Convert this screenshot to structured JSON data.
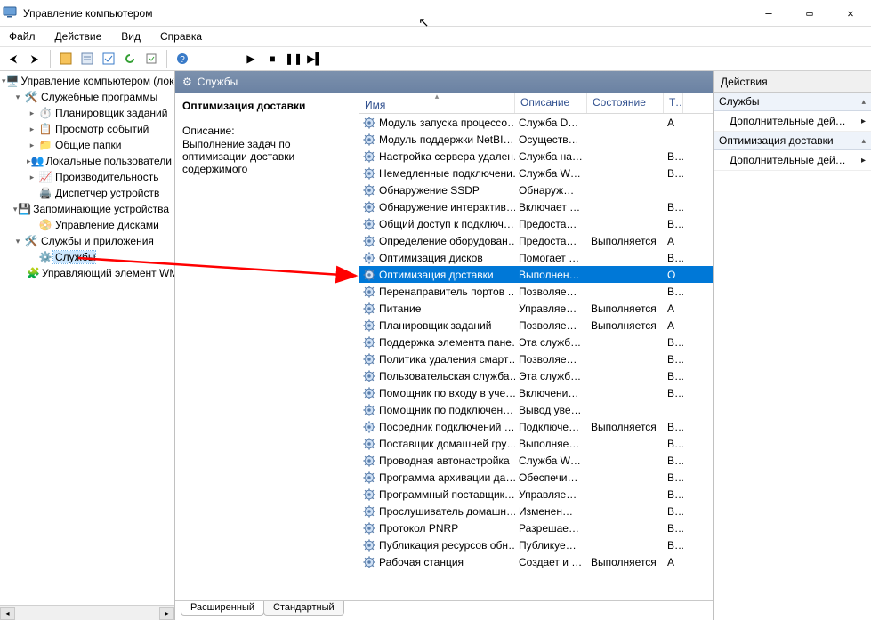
{
  "title": "Управление компьютером",
  "menu": {
    "file": "Файл",
    "action": "Действие",
    "view": "Вид",
    "help": "Справка"
  },
  "tree": {
    "root": {
      "label": "Управление компьютером (локал"
    },
    "syssw": {
      "label": "Служебные программы"
    },
    "scheduler": {
      "label": "Планировщик заданий"
    },
    "eventvwr": {
      "label": "Просмотр событий"
    },
    "shared": {
      "label": "Общие папки"
    },
    "localusers": {
      "label": "Локальные пользователи и"
    },
    "perf": {
      "label": "Производительность"
    },
    "devmgr": {
      "label": "Диспетчер устройств"
    },
    "storage": {
      "label": "Запоминающие устройства"
    },
    "diskmgmt": {
      "label": "Управление дисками"
    },
    "svcapps": {
      "label": "Службы и приложения"
    },
    "services": {
      "label": "Службы"
    },
    "wmi": {
      "label": "Управляющий элемент WM"
    }
  },
  "center": {
    "header": "Службы",
    "sel_title": "Оптимизация доставки",
    "desc_head": "Описание:",
    "desc_body": "Выполнение задач по оптимизации доставки содержимого",
    "cols": {
      "name": "Имя",
      "desc": "Описание",
      "state": "Состояние",
      "type": "Ти"
    },
    "tabs": {
      "extended": "Расширенный",
      "standard": "Стандартный"
    }
  },
  "services": [
    {
      "name": "Модуль запуска процессо…",
      "desc": "Служба D…",
      "state": "",
      "type": "А"
    },
    {
      "name": "Модуль поддержки NetBI…",
      "desc": "Осуществ…",
      "state": "",
      "type": ""
    },
    {
      "name": "Настройка сервера удален…",
      "desc": "Служба на…",
      "state": "",
      "type": "Вр"
    },
    {
      "name": "Немедленные подключени…",
      "desc": "Служба W…",
      "state": "",
      "type": "Вр"
    },
    {
      "name": "Обнаружение SSDP",
      "desc": "Обнаруж…",
      "state": "",
      "type": ""
    },
    {
      "name": "Обнаружение интерактив…",
      "desc": "Включает …",
      "state": "",
      "type": "Вр"
    },
    {
      "name": "Общий доступ к подключ…",
      "desc": "Предоста…",
      "state": "",
      "type": "Вр"
    },
    {
      "name": "Определение оборудован…",
      "desc": "Предоста…",
      "state": "Выполняется",
      "type": "А"
    },
    {
      "name": "Оптимизация дисков",
      "desc": "Помогает …",
      "state": "",
      "type": "Вр"
    },
    {
      "name": "Оптимизация доставки",
      "desc": "Выполнен…",
      "state": "",
      "type": "О",
      "selected": true
    },
    {
      "name": "Перенаправитель портов …",
      "desc": "Позволяе…",
      "state": "",
      "type": "Вр"
    },
    {
      "name": "Питание",
      "desc": "Управляе…",
      "state": "Выполняется",
      "type": "А"
    },
    {
      "name": "Планировщик заданий",
      "desc": "Позволяе…",
      "state": "Выполняется",
      "type": "А"
    },
    {
      "name": "Поддержка элемента пане…",
      "desc": "Эта служб…",
      "state": "",
      "type": "Вр"
    },
    {
      "name": "Политика удаления смарт…",
      "desc": "Позволяе…",
      "state": "",
      "type": "Вр"
    },
    {
      "name": "Пользовательская служба…",
      "desc": "Эта служб…",
      "state": "",
      "type": "Вр"
    },
    {
      "name": "Помощник по входу в уче…",
      "desc": "Включени…",
      "state": "",
      "type": "Вр"
    },
    {
      "name": "Помощник по подключен…",
      "desc": "Вывод уве…",
      "state": "",
      "type": ""
    },
    {
      "name": "Посредник подключений …",
      "desc": "Подключе…",
      "state": "Выполняется",
      "type": "Вр"
    },
    {
      "name": "Поставщик домашней гру…",
      "desc": "Выполняе…",
      "state": "",
      "type": "Вр"
    },
    {
      "name": "Проводная автонастройка",
      "desc": "Служба W…",
      "state": "",
      "type": "Вр"
    },
    {
      "name": "Программа архивации да…",
      "desc": "Обеспечи…",
      "state": "",
      "type": "Вр"
    },
    {
      "name": "Программный поставщик…",
      "desc": "Управляе…",
      "state": "",
      "type": "Вр"
    },
    {
      "name": "Прослушиватель домашн…",
      "desc": "Изменен…",
      "state": "",
      "type": "Вр"
    },
    {
      "name": "Протокол PNRP",
      "desc": "Разрешае…",
      "state": "",
      "type": "Вр"
    },
    {
      "name": "Публикация ресурсов обн…",
      "desc": "Публикуе…",
      "state": "",
      "type": "Вр"
    },
    {
      "name": "Рабочая станция",
      "desc": "Создает и …",
      "state": "Выполняется",
      "type": "А"
    }
  ],
  "actions": {
    "title": "Действия",
    "grp1": "Службы",
    "grp1_more": "Дополнительные дей…",
    "grp2": "Оптимизация доставки",
    "grp2_more": "Дополнительные дей…"
  }
}
